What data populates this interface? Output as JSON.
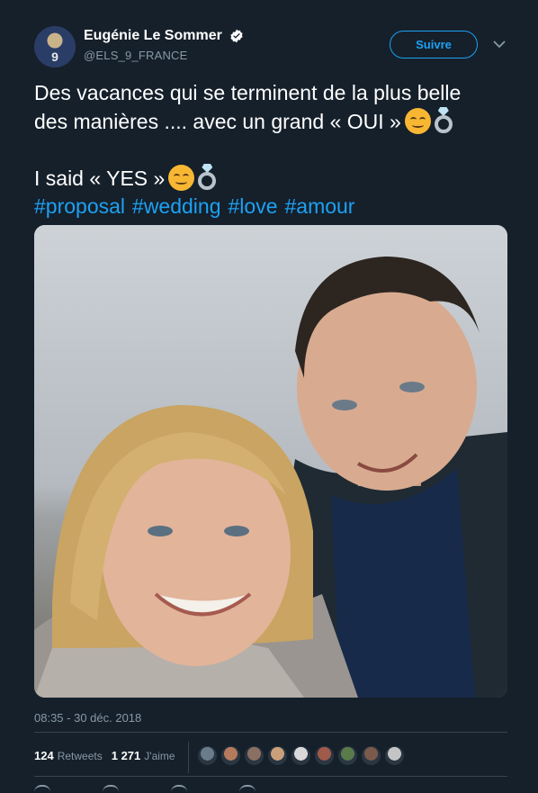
{
  "author": {
    "display_name": "Eugénie Le Sommer",
    "handle": "@ELS_9_FRANCE",
    "avatar_number": "9",
    "verified": true
  },
  "header": {
    "follow_label": "Suivre",
    "menu_icon": "chevron-down-icon"
  },
  "tweet": {
    "line1": "Des vacances qui se terminent de la plus belle",
    "line2": "des manières .... avec un grand « OUI »",
    "line3": "I said « YES »",
    "hashtags": [
      "#proposal",
      "#wedding",
      "#love",
      "#amour"
    ],
    "emojis": [
      "smiling-face-icon",
      "ring-icon"
    ]
  },
  "meta": {
    "timestamp": "08:35 - 30 déc. 2018",
    "retweets_count": "124",
    "retweets_label": "Retweets",
    "likes_count": "1 271",
    "likes_label": "J'aime"
  },
  "likers": [
    "#6a7b8a",
    "#b57a5c",
    "#8b6f63",
    "#c9a07a",
    "#d9d9d9",
    "#a05a4a",
    "#5a7a4a",
    "#7a5a4a",
    "#c4c4c4"
  ],
  "colors": {
    "background": "#15202b",
    "accent": "#1da1f2",
    "secondary_text": "#8899a6"
  }
}
